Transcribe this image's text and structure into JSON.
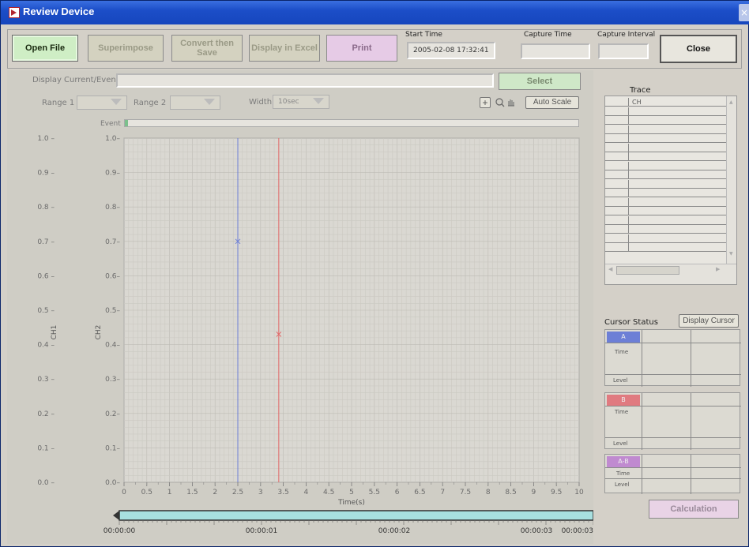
{
  "window": {
    "title": "Review Device",
    "close_glyph": "×"
  },
  "toolbar": {
    "open_file": "Open File",
    "superimpose": "Superimpose",
    "convert_then_save_l1": "Convert then",
    "convert_then_save_l2": "Save",
    "display_in_excel": "Display in Excel",
    "print": "Print",
    "close": "Close",
    "start_time_label": "Start Time",
    "start_time_value": "2005-02-08 17:32:41",
    "capture_time_label": "Capture Time",
    "capture_time_value": "",
    "capture_interval_label": "Capture Interval",
    "capture_interval_value": ""
  },
  "controls": {
    "display_current_event_label": "Display Current/Event",
    "display_current_event_value": "",
    "select_button": "Select",
    "range1_label": "Range 1",
    "range2_label": "Range 2",
    "width_label": "Width",
    "width_value": "10sec",
    "auto_scale": "Auto Scale",
    "event_label": "Event"
  },
  "chart_data": {
    "type": "line",
    "xlabel": "Time(s)",
    "ylabels": [
      "CH1",
      "CH2"
    ],
    "xlim": [
      0,
      10
    ],
    "ylim": [
      0,
      1
    ],
    "x_ticks": [
      "0",
      "0.5",
      "1",
      "1.5",
      "2",
      "2.5",
      "3",
      "3.5",
      "4",
      "4.5",
      "5",
      "5.5",
      "6",
      "6.5",
      "7",
      "7.5",
      "8",
      "8.5",
      "9",
      "9.5",
      "10"
    ],
    "y_ticks": [
      "0.0",
      "0.1",
      "0.2",
      "0.3",
      "0.4",
      "0.5",
      "0.6",
      "0.7",
      "0.8",
      "0.9",
      "1.0"
    ],
    "grid": true,
    "cursors": [
      {
        "name": "A",
        "x": 2.5,
        "marker_y": 0.7,
        "color": "#6d7fd6"
      },
      {
        "name": "B",
        "x": 3.4,
        "marker_y": 0.43,
        "color": "#e06a6a"
      }
    ],
    "timeline_ticks": [
      "00:00:00",
      "00:00:01",
      "00:00:02",
      "00:00:03",
      "00:00:03"
    ]
  },
  "trace": {
    "label": "Trace",
    "rows": [
      "CH",
      "",
      "",
      "",
      "",
      "",
      "",
      "",
      "",
      "",
      "",
      "",
      "",
      "",
      "",
      "",
      ""
    ]
  },
  "cursor_status": {
    "label": "Cursor Status",
    "display_cursor": "Display Cursor",
    "a_label": "A",
    "b_label": "B",
    "ab_label": "A-B",
    "time": "Time",
    "level": "Level",
    "a_color": "#6d7fd6",
    "b_color": "#e07a80",
    "ab_color": "#c08ad0"
  },
  "calculation_button": "Calculation"
}
